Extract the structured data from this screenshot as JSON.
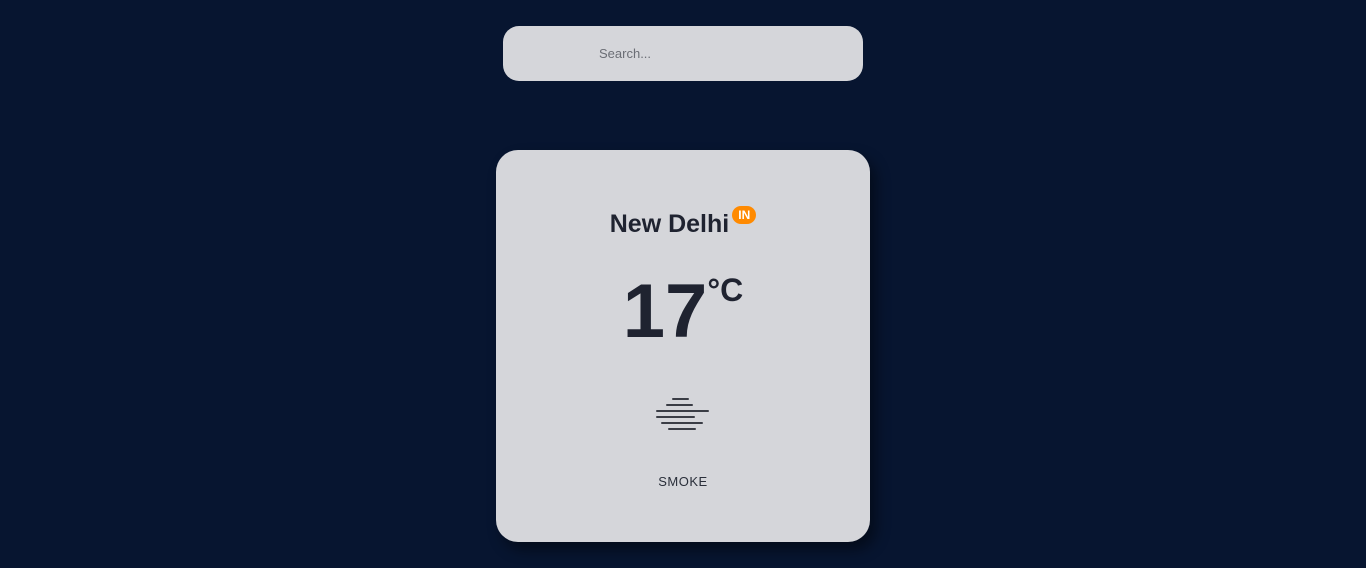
{
  "search": {
    "placeholder": "Search...",
    "value": ""
  },
  "weather": {
    "city": "New Delhi",
    "country": "IN",
    "temperature": "17",
    "unit": "°C",
    "icon": "smoke-icon",
    "description": "SMOKE"
  },
  "colors": {
    "background": "#071530",
    "card": "#d5d6da",
    "text": "#1f2330",
    "badge": "#ff8a00"
  }
}
